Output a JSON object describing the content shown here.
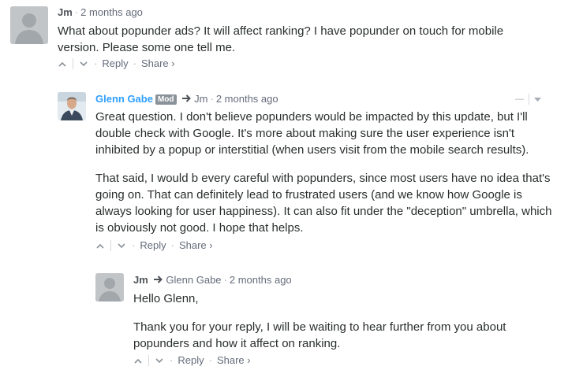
{
  "comments": [
    {
      "author": "Jm",
      "time": "2 months ago",
      "body": [
        "What about popunder ads? It will affect ranking? I have popunder on touch for mobile version. Please some one tell me."
      ],
      "reply": "Reply",
      "share": "Share ›"
    },
    {
      "author": "Glenn Gabe",
      "badge": "Mod",
      "reply_to": "Jm",
      "time": "2 months ago",
      "body": [
        "Great question. I don't believe popunders would be impacted by this update, but I'll double check with Google. It's more about making sure the user experience isn't inhibited by a popup or interstitial (when users visit from the mobile search results).",
        "That said, I would b every careful with popunders, since most users have no idea that's going on. That can definitely lead to frustrated users (and we know how Google is always looking for user happiness). It can also fit under the \"deception\" umbrella, which is obviously not good. I hope that helps."
      ],
      "reply": "Reply",
      "share": "Share ›",
      "menu_collapse": "—"
    },
    {
      "author": "Jm",
      "reply_to": "Glenn Gabe",
      "time": "2 months ago",
      "body": [
        "Hello Glenn,",
        "Thank you for your reply, I will be waiting to hear further from you about popunders and how it affect on ranking."
      ],
      "reply": "Reply",
      "share": "Share ›"
    }
  ],
  "icons": {
    "upvote": "chevron-up-icon",
    "downvote": "chevron-down-icon",
    "reply_arrow": "reply-arrow-icon",
    "menu": "caret-down-icon"
  },
  "colors": {
    "mod_name": "#2e9fff",
    "meta": "#656c7a",
    "badge_bg": "#8a9299"
  }
}
